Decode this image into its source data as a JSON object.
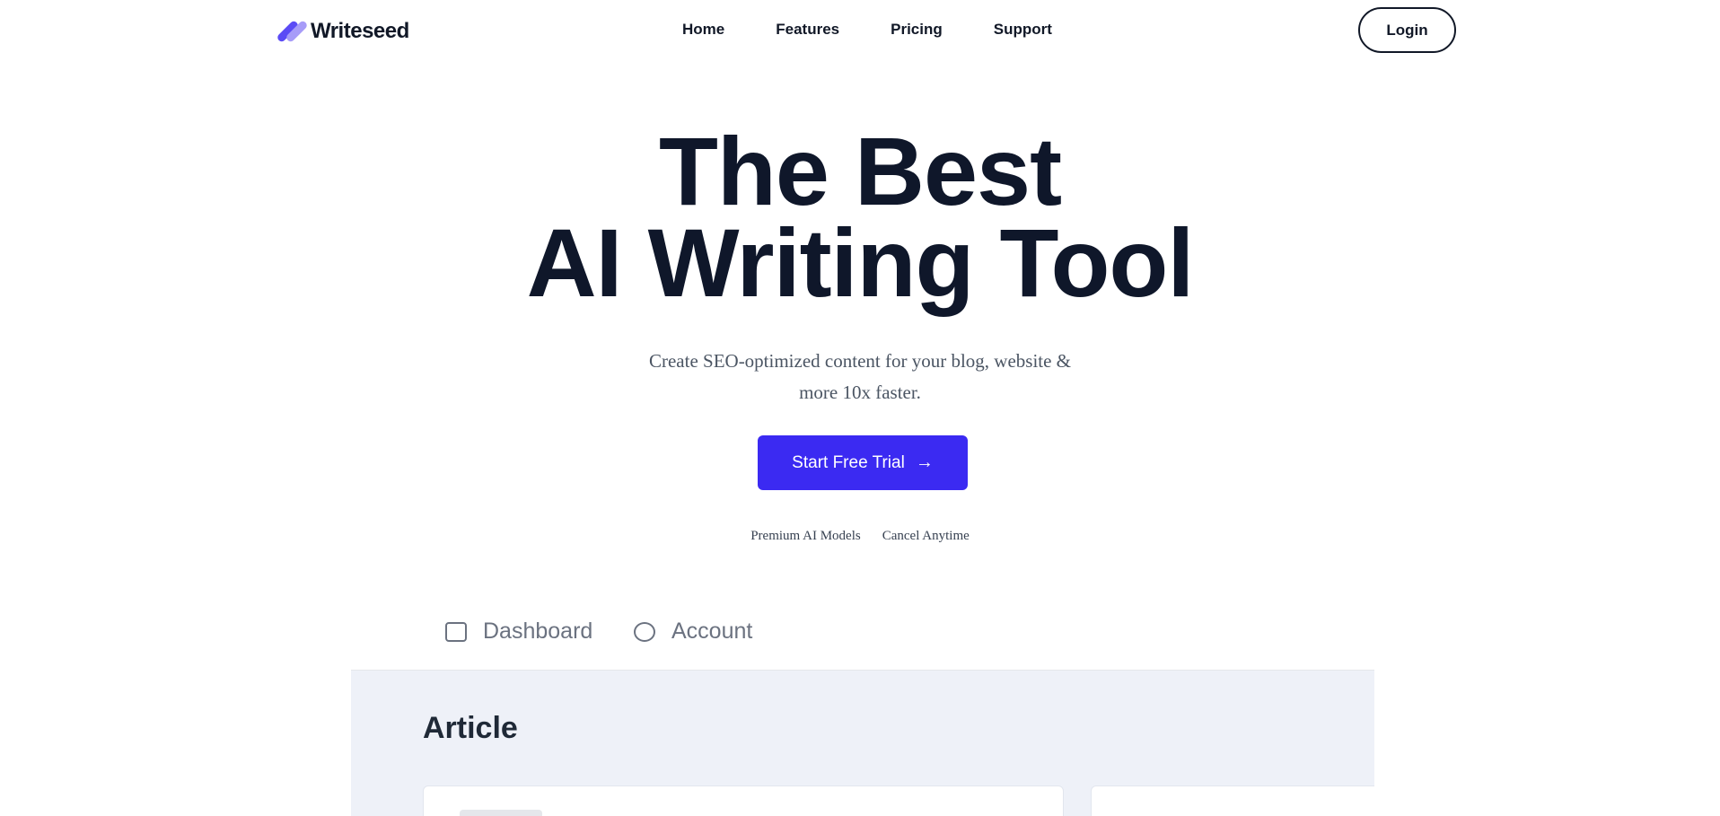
{
  "brand": {
    "name": "Writeseed",
    "colors": {
      "primary": "#3b2af2",
      "logo_dark": "#5b4bf5",
      "logo_light": "#a79cf8"
    }
  },
  "nav": {
    "items": [
      "Home",
      "Features",
      "Pricing",
      "Support"
    ],
    "login_label": "Login"
  },
  "hero": {
    "title_line1": "The Best",
    "title_line2": "AI Writing Tool",
    "subtitle_line1": "Create SEO-optimized content for your blog, website &",
    "subtitle_line2": "more 10x faster.",
    "cta_label": "Start Free Trial",
    "cta_icon": "arrow-right-icon",
    "features": [
      "Premium AI Models",
      "Cancel Anytime"
    ]
  },
  "preview": {
    "tabs": [
      {
        "label": "Dashboard",
        "icon": "dashboard-icon"
      },
      {
        "label": "Account",
        "icon": "account-icon"
      }
    ],
    "section_title": "Article"
  }
}
